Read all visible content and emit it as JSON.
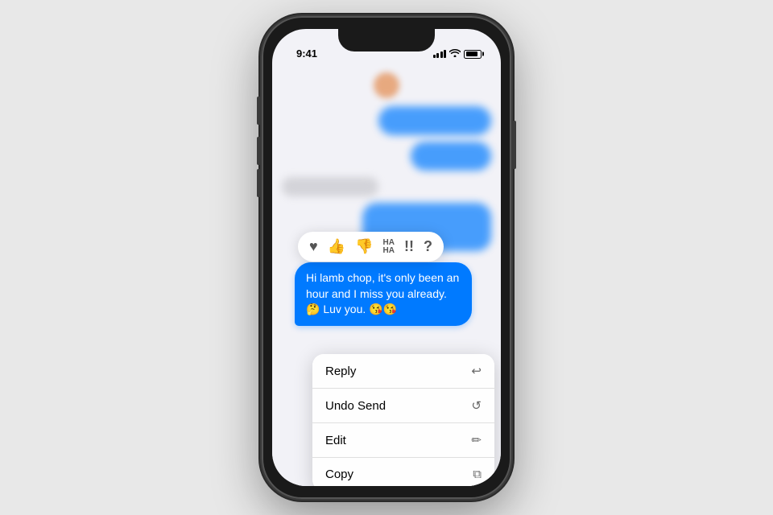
{
  "scene": {
    "background_color": "#e8e8e8"
  },
  "status_bar": {
    "time": "9:41",
    "signal_label": "signal",
    "wifi_label": "wifi",
    "battery_label": "battery"
  },
  "message": {
    "text": "Hi lamb chop, it's only been an hour and I miss you already. 🤔\nLuv you. 😘😘"
  },
  "reactions": {
    "heart": "♥",
    "thumbs_up": "👍",
    "thumbs_down": "👎",
    "ha_ha": "HА\nНА",
    "exclamation": "‼",
    "question": "?"
  },
  "context_menu": {
    "items": [
      {
        "id": "reply",
        "label": "Reply",
        "icon": "↩"
      },
      {
        "id": "undo-send",
        "label": "Undo Send",
        "icon": "↺"
      },
      {
        "id": "edit",
        "label": "Edit",
        "icon": "✏"
      },
      {
        "id": "copy",
        "label": "Copy",
        "icon": "⧉"
      }
    ]
  }
}
